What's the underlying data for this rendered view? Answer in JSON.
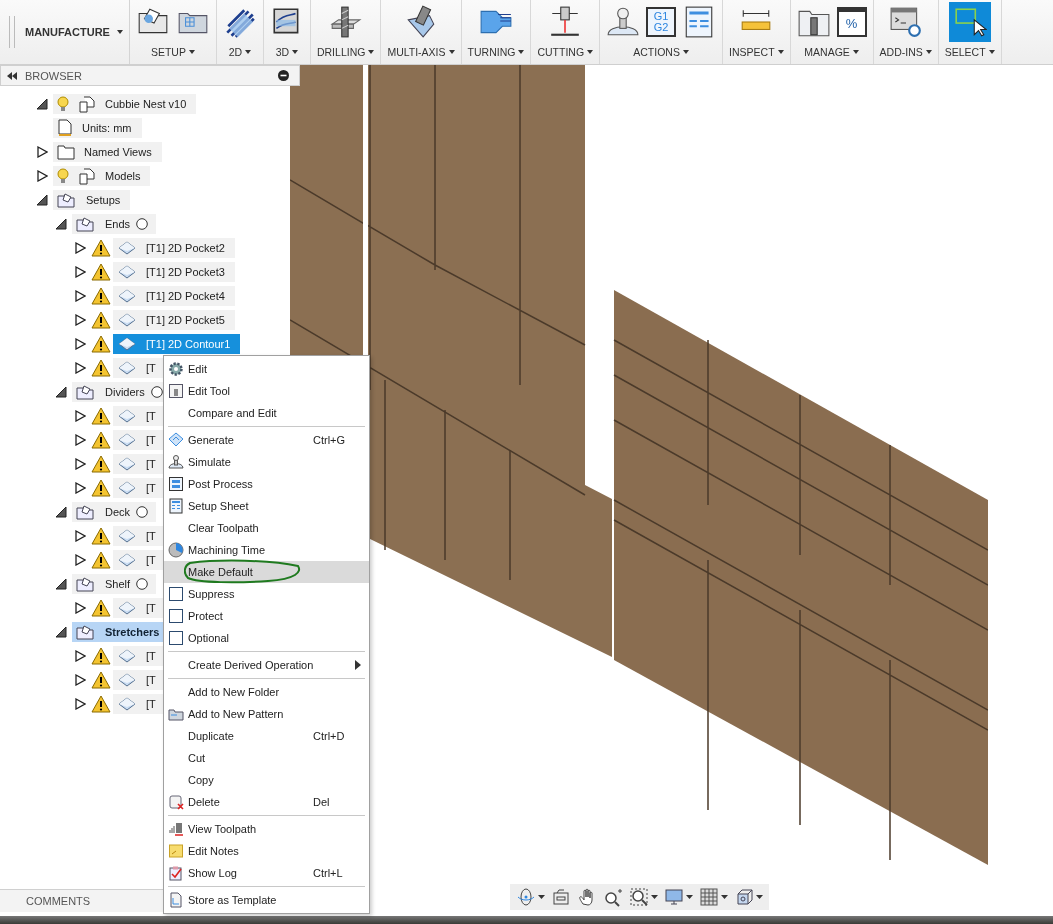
{
  "toolbar": {
    "workspace": "MANUFACTURE",
    "groups": [
      {
        "label": "SETUP",
        "tools": [
          {
            "kind": "setup"
          },
          {
            "kind": "fixture-setup"
          }
        ]
      },
      {
        "label": "2D",
        "tools": [
          {
            "kind": "stripes"
          }
        ]
      },
      {
        "label": "3D",
        "tools": [
          {
            "kind": "block"
          }
        ]
      },
      {
        "label": "DRILLING",
        "tools": [
          {
            "kind": "drill"
          }
        ]
      },
      {
        "label": "MULTI-AXIS",
        "tools": [
          {
            "kind": "multi-axis"
          }
        ]
      },
      {
        "label": "TURNING",
        "tools": [
          {
            "kind": "turning"
          }
        ]
      },
      {
        "label": "CUTTING",
        "tools": [
          {
            "kind": "cutting"
          }
        ]
      },
      {
        "label": "ACTIONS",
        "tools": [
          {
            "kind": "simulate"
          },
          {
            "kind": "code",
            "text": [
              "G1",
              "G2"
            ]
          },
          {
            "kind": "sheet"
          }
        ]
      },
      {
        "label": "INSPECT",
        "tools": [
          {
            "kind": "ruler"
          }
        ]
      },
      {
        "label": "MANAGE",
        "tools": [
          {
            "kind": "tool-library"
          },
          {
            "kind": "percent",
            "text": [
              "%"
            ]
          }
        ]
      },
      {
        "label": "ADD-INS",
        "tools": [
          {
            "kind": "scripts"
          }
        ]
      },
      {
        "label": "SELECT",
        "selected": true,
        "tools": [
          {
            "kind": "select"
          }
        ]
      }
    ]
  },
  "browser": {
    "title": "BROWSER",
    "tree": [
      {
        "label": "Cubbie Nest v10",
        "kind": "component",
        "visible": true,
        "expanded": true,
        "selected": false,
        "children": [
          {
            "label": "Units: mm",
            "kind": "units",
            "selected": false
          },
          {
            "label": "Named Views",
            "kind": "folder",
            "expanded": false,
            "selected": false
          },
          {
            "label": "Models",
            "kind": "models",
            "visible": true,
            "expanded": false,
            "selected": false
          },
          {
            "label": "Setups",
            "kind": "setups",
            "expanded": true,
            "selected": false,
            "children": [
              {
                "label": "Ends",
                "kind": "setup",
                "expanded": true,
                "selected": false,
                "children": [
                  {
                    "label": "[T1] 2D Pocket2",
                    "kind": "operation",
                    "warning": true,
                    "expanded": false,
                    "selected": false
                  },
                  {
                    "label": "[T1] 2D Pocket3",
                    "kind": "operation",
                    "warning": true,
                    "expanded": false,
                    "selected": false
                  },
                  {
                    "label": "[T1] 2D Pocket4",
                    "kind": "operation",
                    "warning": true,
                    "expanded": false,
                    "selected": false
                  },
                  {
                    "label": "[T1] 2D Pocket5",
                    "kind": "operation",
                    "warning": true,
                    "expanded": false,
                    "selected": false
                  },
                  {
                    "label": "[T1] 2D Contour1",
                    "kind": "operation",
                    "warning": true,
                    "expanded": false,
                    "selected": true
                  },
                  {
                    "label": "[T",
                    "kind": "operation",
                    "warning": true,
                    "expanded": false,
                    "selected": false
                  }
                ]
              },
              {
                "label": "Dividers",
                "kind": "setup",
                "expanded": true,
                "selected": false,
                "children": [
                  {
                    "label": "[T",
                    "kind": "operation",
                    "warning": true,
                    "expanded": false,
                    "selected": false
                  },
                  {
                    "label": "[T",
                    "kind": "operation",
                    "warning": true,
                    "expanded": false,
                    "selected": false
                  },
                  {
                    "label": "[T",
                    "kind": "operation",
                    "warning": true,
                    "expanded": false,
                    "selected": false
                  },
                  {
                    "label": "[T",
                    "kind": "operation",
                    "warning": true,
                    "expanded": false,
                    "selected": false
                  }
                ]
              },
              {
                "label": "Deck",
                "kind": "setup",
                "expanded": true,
                "selected": false,
                "children": [
                  {
                    "label": "[T",
                    "kind": "operation",
                    "warning": true,
                    "expanded": false,
                    "selected": false
                  },
                  {
                    "label": "[T",
                    "kind": "operation",
                    "warning": true,
                    "expanded": false,
                    "selected": false
                  }
                ]
              },
              {
                "label": "Shelf",
                "kind": "setup",
                "expanded": true,
                "selected": false,
                "children": [
                  {
                    "label": "[T",
                    "kind": "operation",
                    "warning": true,
                    "expanded": false,
                    "selected": false
                  }
                ]
              },
              {
                "label": "Stretchers",
                "kind": "setup",
                "expanded": true,
                "selected": true,
                "children": [
                  {
                    "label": "[T",
                    "kind": "operation",
                    "warning": true,
                    "expanded": false,
                    "selected": false
                  },
                  {
                    "label": "[T",
                    "kind": "operation",
                    "warning": true,
                    "expanded": false,
                    "selected": false
                  },
                  {
                    "label": "[T",
                    "kind": "operation",
                    "warning": true,
                    "expanded": false,
                    "selected": false
                  }
                ]
              }
            ]
          }
        ]
      }
    ]
  },
  "comments": {
    "title": "COMMENTS"
  },
  "context_menu": {
    "sections": [
      [
        {
          "label": "Edit",
          "kind": "gear",
          "hovered": false
        },
        {
          "label": "Edit Tool",
          "kind": "tool",
          "hovered": false
        },
        {
          "label": "Compare and Edit",
          "hovered": false
        }
      ],
      [
        {
          "label": "Generate",
          "kind": "generate",
          "shortcut": "Ctrl+G",
          "hovered": false
        },
        {
          "label": "Simulate",
          "kind": "simulate",
          "hovered": false
        },
        {
          "label": "Post Process",
          "kind": "code",
          "hovered": false
        },
        {
          "label": "Setup Sheet",
          "kind": "sheet",
          "hovered": false
        },
        {
          "label": "Clear Toolpath",
          "hovered": false
        },
        {
          "label": "Machining Time",
          "kind": "pie",
          "hovered": false
        },
        {
          "label": "Make Default",
          "hovered": true,
          "circled": true
        },
        {
          "label": "Suppress",
          "kind": "checkbox",
          "checked": false,
          "hovered": false
        },
        {
          "label": "Protect",
          "kind": "checkbox",
          "checked": false,
          "hovered": false
        },
        {
          "label": "Optional",
          "kind": "checkbox",
          "checked": false,
          "hovered": false
        }
      ],
      [
        {
          "label": "Create Derived Operation",
          "kind": "submenu",
          "hovered": false
        }
      ],
      [
        {
          "label": "Add to New Folder",
          "hovered": false
        },
        {
          "label": "Add to New Pattern",
          "kind": "pattern",
          "hovered": false
        },
        {
          "label": "Duplicate",
          "shortcut": "Ctrl+D",
          "hovered": false
        },
        {
          "label": "Cut",
          "hovered": false
        },
        {
          "label": "Copy",
          "hovered": false
        },
        {
          "label": "Delete",
          "kind": "delete",
          "shortcut": "Del",
          "hovered": false
        }
      ],
      [
        {
          "label": "View Toolpath",
          "kind": "view-toolpath",
          "hovered": false
        },
        {
          "label": "Edit Notes",
          "kind": "notes",
          "hovered": false
        },
        {
          "label": "Show Log",
          "kind": "log",
          "shortcut": "Ctrl+L",
          "hovered": false
        }
      ],
      [
        {
          "label": "Store as Template",
          "kind": "template",
          "hovered": false
        }
      ]
    ]
  },
  "navigation_bar": [
    {
      "kind": "orbit",
      "dropdown": true
    },
    {
      "kind": "camera",
      "dropdown": false
    },
    {
      "kind": "pan",
      "dropdown": false
    },
    {
      "kind": "zoom",
      "dropdown": false
    },
    {
      "kind": "fit",
      "dropdown": true
    },
    {
      "kind": "display",
      "dropdown": true
    },
    {
      "kind": "grid",
      "dropdown": true
    },
    {
      "kind": "view-cube",
      "dropdown": true
    }
  ]
}
